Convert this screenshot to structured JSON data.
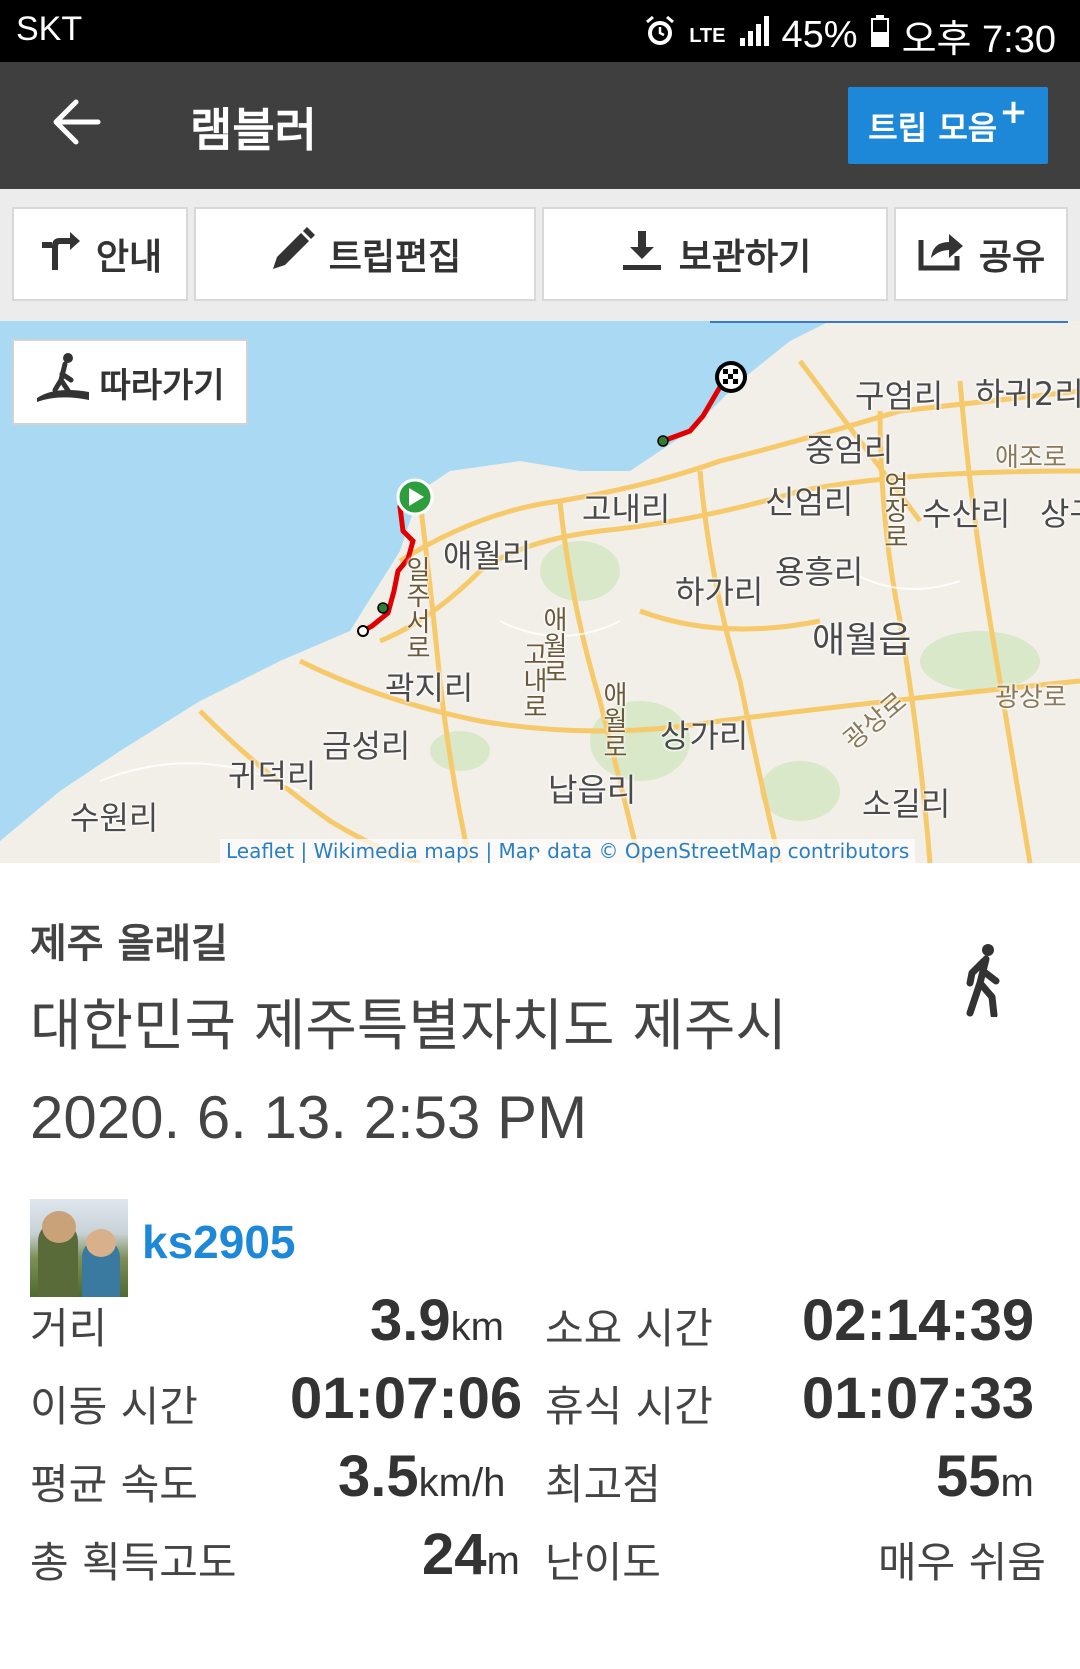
{
  "status_bar": {
    "carrier": "SKT",
    "network": "LTE",
    "battery": "45%",
    "time": "오후 7:30",
    "icons": [
      "alarm-icon",
      "lte-icon",
      "signal-icon",
      "battery-icon"
    ]
  },
  "app_bar": {
    "title": "램블러",
    "collect_button": "트립 모음",
    "collect_plus": "+"
  },
  "toolbar": {
    "guide": "안내",
    "edit": "트립편집",
    "save": "보관하기",
    "share": "공유"
  },
  "map": {
    "follow_button": "따라가기",
    "attribution": "Leaflet | Wikimedia maps | Map data © OpenStreetMap contributors",
    "labels": {
      "gueomri": "구엄리",
      "hagwi2ri": "하귀2리",
      "jungeomri": "중엄리",
      "aejoro": "애조로",
      "sineomri": "신엄리",
      "susanri": "수산리",
      "sang": "상구",
      "gonaeri": "고내리",
      "aewolri": "애월리",
      "yongheungri": "용흥리",
      "hagari": "하가리",
      "aewoleup": "애월읍",
      "gwakjiri": "곽지리",
      "gwangsangro": "광상로",
      "gwangsangro2": "광상로",
      "sanggari": "상가리",
      "geumseongri": "금성리",
      "gwideokri": "귀덕리",
      "napeupri": "납읍리",
      "suwonri": "수원리",
      "sogilri": "소길리",
      "ilju": "일주서로",
      "aewolro": "애월로",
      "aewolro2": "애월로",
      "gonaero": "고내로",
      "eomjeong": "엄장로"
    },
    "colors": {
      "sea": "#aadaf3",
      "land": "#f2efe9",
      "road": "#f6c96b",
      "route": "#e00000"
    }
  },
  "trip": {
    "category": "제주 올래길",
    "location": "대한민국 제주특별자치도 제주시",
    "datetime": "2020. 6. 13. 2:53 PM",
    "activity_icon": "walking-icon",
    "username": "ks2905"
  },
  "stats": {
    "distance_label": "거리",
    "distance_value": "3.9",
    "distance_unit": "km",
    "duration_label": "소요 시간",
    "duration_value": "02:14:39",
    "moving_label": "이동 시간",
    "moving_value": "01:07:06",
    "rest_label": "휴식 시간",
    "rest_value": "01:07:33",
    "avg_speed_label": "평균 속도",
    "avg_speed_value": "3.5",
    "avg_speed_unit": "km/h",
    "max_alt_label": "최고점",
    "max_alt_value": "55",
    "max_alt_unit": "m",
    "gain_label": "총 획득고도",
    "gain_value": "24",
    "gain_unit": "m",
    "difficulty_label": "난이도",
    "difficulty_value": "매우 쉬움"
  }
}
